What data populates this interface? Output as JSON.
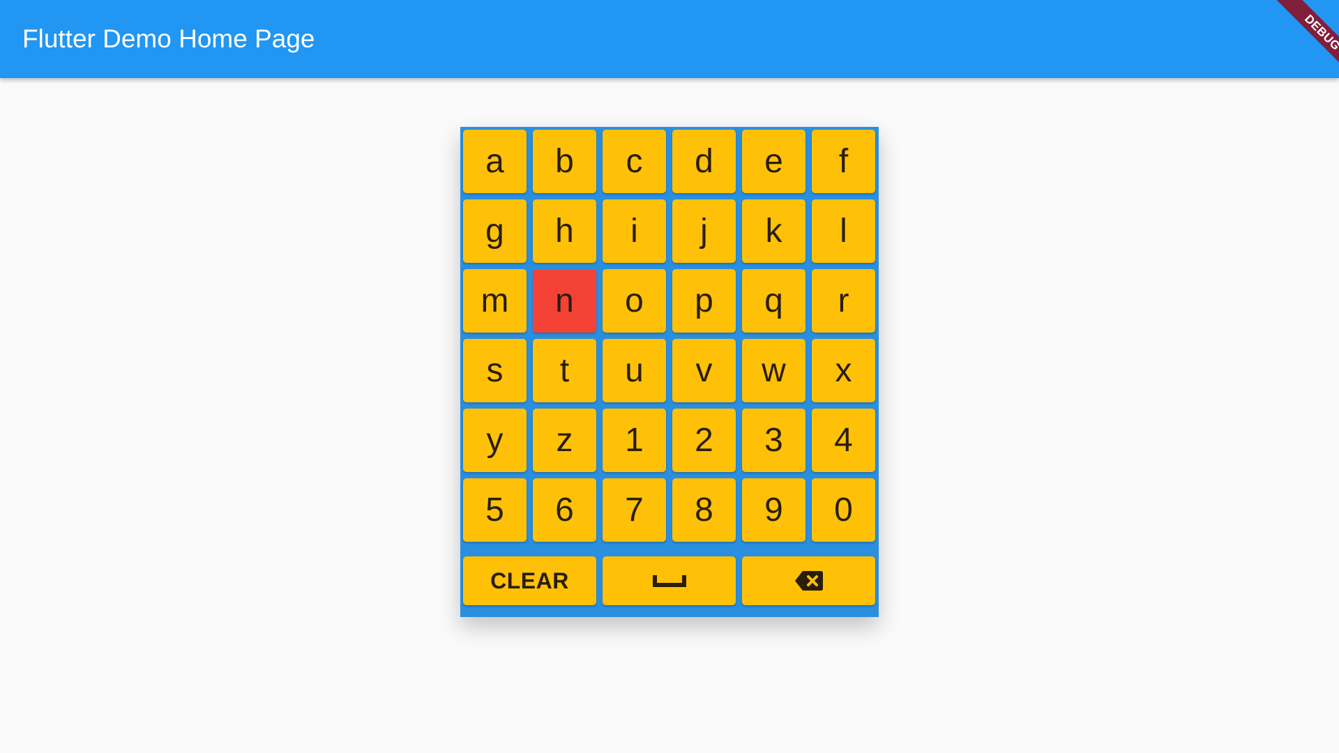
{
  "app_bar": {
    "title": "Flutter Demo Home Page",
    "color": "#2196f3"
  },
  "debug_banner": {
    "label": "DEBUG"
  },
  "keyboard": {
    "background_color": "#2a8fe0",
    "key_color": "#ffc107",
    "active_key_color": "#f44336",
    "active_key": "n",
    "keys": [
      "a",
      "b",
      "c",
      "d",
      "e",
      "f",
      "g",
      "h",
      "i",
      "j",
      "k",
      "l",
      "m",
      "n",
      "o",
      "p",
      "q",
      "r",
      "s",
      "t",
      "u",
      "v",
      "w",
      "x",
      "y",
      "z",
      "1",
      "2",
      "3",
      "4",
      "5",
      "6",
      "7",
      "8",
      "9",
      "0"
    ],
    "actions": {
      "clear_label": "CLEAR",
      "space_icon": "space-bar-icon",
      "backspace_icon": "backspace-icon"
    }
  }
}
